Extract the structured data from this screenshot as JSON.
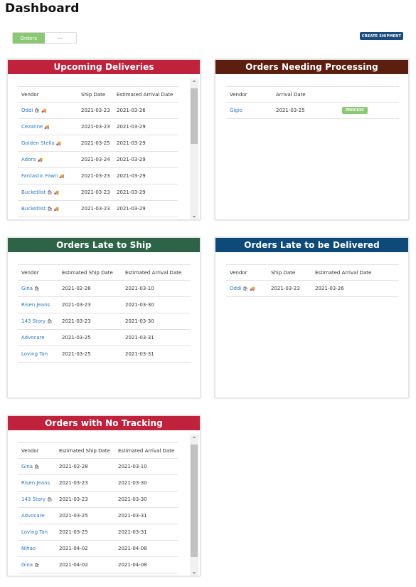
{
  "page": {
    "title": "Dashboard"
  },
  "toolbar": {
    "toggle_active": "Orders",
    "toggle_other": "---",
    "create_label": "CREATE SHIPMENT"
  },
  "upcoming": {
    "title": "Upcoming Deliveries",
    "color": "#c0213b",
    "columns": [
      "Vendor",
      "Ship Date",
      "Estimated Arrival Date"
    ],
    "rows": [
      {
        "vendor": "Oddi",
        "bag": true,
        "truck": true,
        "ship": "2021-03-23",
        "arrival": "2021-03-26"
      },
      {
        "vendor": "Cezanne",
        "bag": false,
        "truck": true,
        "ship": "2021-03-23",
        "arrival": "2021-03-29"
      },
      {
        "vendor": "Golden Stella",
        "bag": false,
        "truck": true,
        "ship": "2021-03-25",
        "arrival": "2021-03-29"
      },
      {
        "vendor": "Adora",
        "bag": false,
        "truck": true,
        "ship": "2021-03-24",
        "arrival": "2021-03-29"
      },
      {
        "vendor": "Fantastic Fawn",
        "bag": false,
        "truck": true,
        "ship": "2021-03-23",
        "arrival": "2021-03-29"
      },
      {
        "vendor": "Bucketlist",
        "bag": true,
        "truck": true,
        "ship": "2021-03-23",
        "arrival": "2021-03-29"
      },
      {
        "vendor": "Bucketlist",
        "bag": true,
        "truck": true,
        "ship": "2021-03-23",
        "arrival": "2021-03-29"
      }
    ]
  },
  "processing": {
    "title": "Orders Needing Processing",
    "color": "#5c1e0f",
    "columns": [
      "Vendor",
      "Arrival Date"
    ],
    "rows": [
      {
        "vendor": "Gigio",
        "arrival": "2021-03-25",
        "action": "PROCESS"
      }
    ]
  },
  "late_ship": {
    "title": "Orders Late to Ship",
    "color": "#2d6448",
    "columns": [
      "Vendor",
      "Estimated Ship Date",
      "Estimated Arrival Date"
    ],
    "rows": [
      {
        "vendor": "Gina",
        "bag": true,
        "ship": "2021-02-28",
        "arrival": "2021-03-10"
      },
      {
        "vendor": "Risen Jeans",
        "bag": false,
        "ship": "2021-03-23",
        "arrival": "2021-03-30"
      },
      {
        "vendor": "143 Story",
        "bag": true,
        "ship": "2021-03-23",
        "arrival": "2021-03-30"
      },
      {
        "vendor": "Advocare",
        "bag": false,
        "ship": "2021-03-25",
        "arrival": "2021-03-31"
      },
      {
        "vendor": "Loving Tan",
        "bag": false,
        "ship": "2021-03-25",
        "arrival": "2021-03-31"
      }
    ]
  },
  "late_deliver": {
    "title": "Orders Late to be Delivered",
    "color": "#0d4a7a",
    "columns": [
      "Vendor",
      "Ship Date",
      "Estimated Arrival Date"
    ],
    "rows": [
      {
        "vendor": "Oddi",
        "bag": true,
        "truck": true,
        "ship": "2021-03-23",
        "arrival": "2021-03-26"
      }
    ]
  },
  "no_tracking": {
    "title": "Orders with No Tracking",
    "color": "#c0213b",
    "columns": [
      "Vendor",
      "Estimated Ship Date",
      "Estimated Arrival Date"
    ],
    "rows": [
      {
        "vendor": "Gina",
        "bag": true,
        "ship": "2021-02-28",
        "arrival": "2021-03-10"
      },
      {
        "vendor": "Risen Jeans",
        "bag": false,
        "ship": "2021-03-23",
        "arrival": "2021-03-30"
      },
      {
        "vendor": "143 Story",
        "bag": true,
        "ship": "2021-03-23",
        "arrival": "2021-03-30"
      },
      {
        "vendor": "Advocare",
        "bag": false,
        "ship": "2021-03-25",
        "arrival": "2021-03-31"
      },
      {
        "vendor": "Loving Tan",
        "bag": false,
        "ship": "2021-03-25",
        "arrival": "2021-03-31"
      },
      {
        "vendor": "Nihao",
        "bag": false,
        "ship": "2021-04-02",
        "arrival": "2021-04-08"
      },
      {
        "vendor": "Gina",
        "bag": true,
        "ship": "2021-04-02",
        "arrival": "2021-04-08"
      }
    ]
  },
  "icons": {
    "bag": "shopping-bag-icon",
    "truck": "truck-icon",
    "scroll_up": "chevron-up-icon",
    "scroll_down": "chevron-down-icon"
  }
}
